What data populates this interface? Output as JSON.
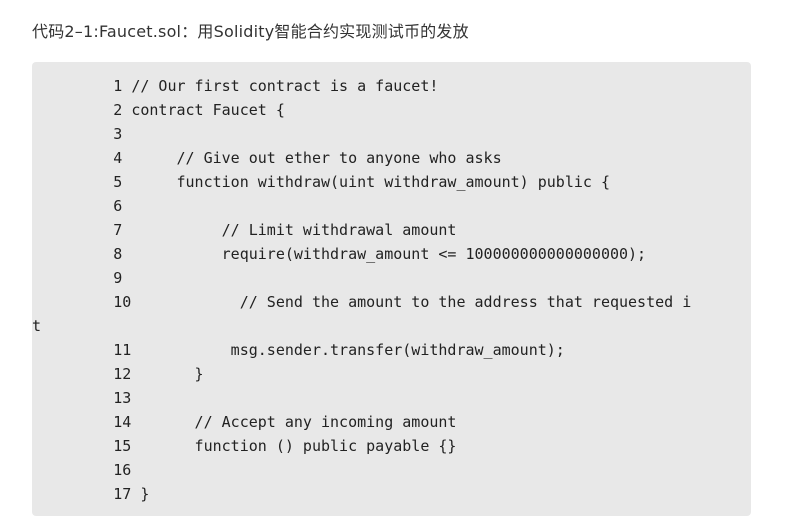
{
  "caption": "代码2–1:Faucet.sol：用Solidity智能合约实现测试币的发放",
  "code_lines": [
    "         1 // Our first contract is a faucet!",
    "         2 contract Faucet {",
    "         3",
    "         4      // Give out ether to anyone who asks",
    "         5      function withdraw(uint withdraw_amount) public {",
    "         6",
    "         7           // Limit withdrawal amount",
    "         8           require(withdraw_amount <= 100000000000000000);",
    "         9",
    "         10            // Send the amount to the address that requested i",
    "t",
    "         11           msg.sender.transfer(withdraw_amount);",
    "         12       }",
    "         13",
    "         14       // Accept any incoming amount",
    "         15       function () public payable {}",
    "         16",
    "         17 }"
  ]
}
